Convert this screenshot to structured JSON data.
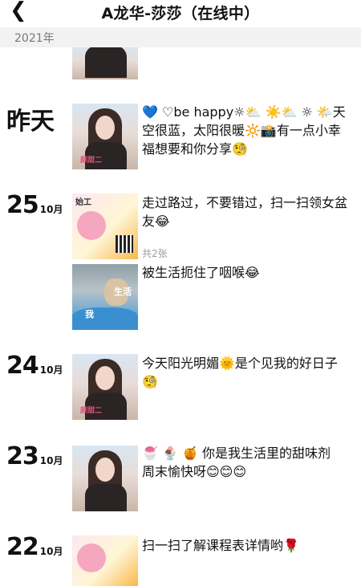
{
  "header": {
    "back_icon": "chevron-left-icon",
    "title": "A龙华-莎莎（在线中）"
  },
  "year_label": "2021年",
  "posts": [
    {
      "day_word": "昨天",
      "text": "💙 ♡be happy☼⛅ ☀️⛅ ☼ 🌤️天空很蓝，太阳很暖🔆📸有一点小幸福想要和你分享🧐",
      "thumb_tag": "颜甜二"
    },
    {
      "day_num": "25",
      "month": "10月",
      "text": "走过路过，不要错过，扫一扫领女盆友😂",
      "count_label": "共2张",
      "thumb_tag": "始工"
    },
    {
      "text": "被生活扼住了咽喉😂",
      "thumb_label_1": "生活",
      "thumb_label_2": "我"
    },
    {
      "day_num": "24",
      "month": "10月",
      "text": "今天阳光明媚🌞是个见我的好日子🧐",
      "thumb_tag": "颜甜二"
    },
    {
      "day_num": "23",
      "month": "10月",
      "text": "🍧 🍨 🍯 你是我生活里的甜味剂\n周末愉快呀😊😊😊"
    },
    {
      "day_num": "22",
      "month": "10月",
      "text": "扫一扫了解课程表详情哟🌹"
    }
  ]
}
